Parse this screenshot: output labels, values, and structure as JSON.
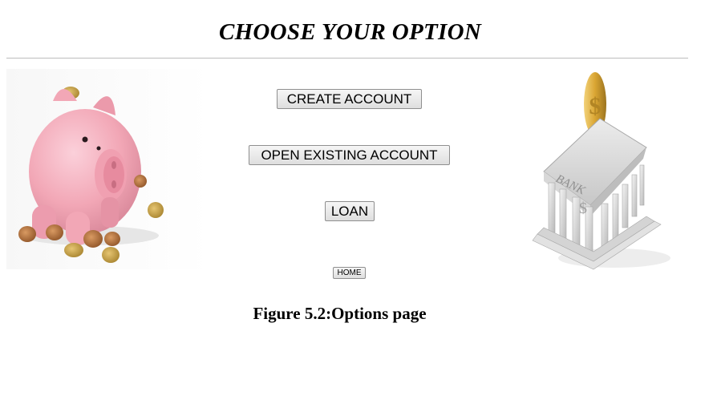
{
  "page": {
    "title": "CHOOSE YOUR OPTION"
  },
  "options": {
    "create_account": "CREATE ACCOUNT",
    "open_existing_account": "OPEN EXISTING ACCOUNT",
    "loan": "LOAN",
    "home": "HOME"
  },
  "images": {
    "left": "piggy-bank-with-coins",
    "right": "bank-building-with-gold-coin",
    "bank_sign": "BANK",
    "bank_symbol": "$",
    "coin_symbol": "$"
  },
  "caption": "Figure 5.2:Options page",
  "colors": {
    "piggy_pink": "#f2a7b6",
    "coin_gold": "#d9a532",
    "coin_copper": "#b06f3a",
    "bank_gray": "#d5d5d5"
  }
}
